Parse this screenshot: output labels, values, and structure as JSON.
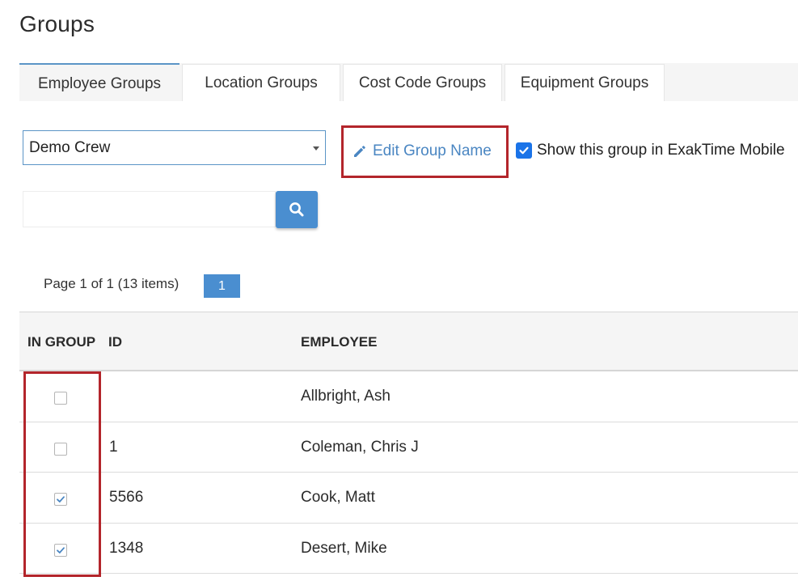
{
  "page": {
    "title": "Groups"
  },
  "tabs": [
    {
      "label": "Employee Groups",
      "active": true
    },
    {
      "label": "Location Groups",
      "active": false
    },
    {
      "label": "Cost Code Groups",
      "active": false
    },
    {
      "label": "Equipment Groups",
      "active": false
    }
  ],
  "group_select": {
    "selected": "Demo Crew"
  },
  "edit_group": {
    "label": "Edit Group Name"
  },
  "show_mobile": {
    "label": "Show this group in ExakTime Mobile",
    "checked": true
  },
  "search": {
    "value": "",
    "placeholder": ""
  },
  "pager": {
    "info": "Page 1 of 1 (13 items)",
    "current_page": "1"
  },
  "table": {
    "columns": {
      "in_group": "IN GROUP",
      "id": "ID",
      "employee": "EMPLOYEE"
    },
    "rows": [
      {
        "in_group": false,
        "id": "",
        "employee": "Allbright, Ash"
      },
      {
        "in_group": false,
        "id": "1",
        "employee": "Coleman, Chris J"
      },
      {
        "in_group": true,
        "id": "5566",
        "employee": "Cook, Matt"
      },
      {
        "in_group": true,
        "id": "1348",
        "employee": "Desert, Mike"
      }
    ]
  },
  "colors": {
    "accent": "#4a8ed0",
    "link": "#4a86c2",
    "highlight": "#b3252b",
    "checkbox_blue": "#1a73e8"
  },
  "icons": {
    "edit": "pencil-icon",
    "search": "magnifier-icon",
    "dropdown": "caret-down-icon",
    "check": "checkmark-icon"
  }
}
